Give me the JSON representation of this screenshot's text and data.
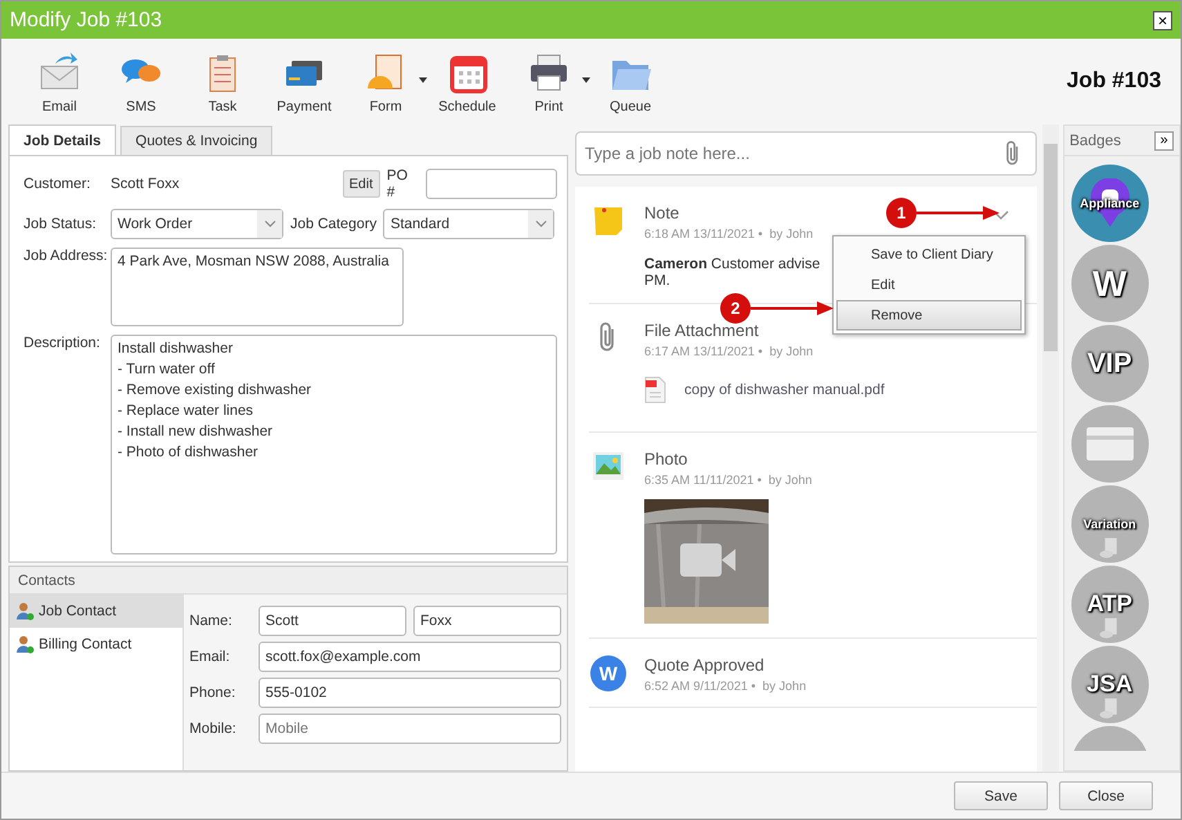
{
  "window": {
    "title": "Modify Job #103",
    "close": "×"
  },
  "toolbar": [
    {
      "label": "Email",
      "dropdown": false
    },
    {
      "label": "SMS",
      "dropdown": false
    },
    {
      "label": "Task",
      "dropdown": false
    },
    {
      "label": "Payment",
      "dropdown": false
    },
    {
      "label": "Form",
      "dropdown": true
    },
    {
      "label": "Schedule",
      "dropdown": false
    },
    {
      "label": "Print",
      "dropdown": true
    },
    {
      "label": "Queue",
      "dropdown": false
    }
  ],
  "job_number": "Job #103",
  "tabs": [
    {
      "label": "Job Details",
      "selected": true
    },
    {
      "label": "Quotes & Invoicing",
      "selected": false
    }
  ],
  "form": {
    "customer_label": "Customer:",
    "customer": "Scott Foxx",
    "edit_button": "Edit",
    "po_label": "PO #",
    "status_label": "Job Status:",
    "status": "Work Order",
    "category_label": "Job Category",
    "category": "Standard",
    "address_label": "Job Address:",
    "address": "4 Park Ave, Mosman NSW 2088, Australia",
    "description_label": "Description:",
    "description": "Install dishwasher\n- Turn water off\n- Remove existing dishwasher\n- Replace water lines\n- Install new dishwasher\n- Photo of dishwasher"
  },
  "contacts": {
    "title": "Contacts",
    "items": [
      {
        "label": "Job Contact",
        "selected": true
      },
      {
        "label": "Billing Contact",
        "selected": false
      }
    ],
    "fields": [
      {
        "label": "Name:",
        "values": [
          "Scott",
          "Foxx"
        ]
      },
      {
        "label": "Email:",
        "values": [
          "scott.fox@example.com"
        ]
      },
      {
        "label": "Phone:",
        "values": [
          "555-0102"
        ]
      },
      {
        "label": "Mobile:",
        "placeholder": "Mobile"
      }
    ]
  },
  "note_input": {
    "placeholder": "Type a job note here..."
  },
  "feed": [
    {
      "kind": "note",
      "title": "Note",
      "meta": "6:18 AM 13/11/2021 •",
      "by": "by John",
      "lines": [
        "**Cameron** Customer advise",
        "PM."
      ]
    },
    {
      "kind": "file",
      "title": "File Attachment",
      "meta": "6:17 AM 13/11/2021 •",
      "by": "by John",
      "file": "copy of dishwasher manual.pdf"
    },
    {
      "title": "Photo",
      "meta": "6:35 AM 11/11/2021 •",
      "by": "by John"
    },
    {
      "kind": "quote",
      "title": "Quote Approved",
      "meta": "6:52 AM 9/11/2021 •",
      "by": "by John",
      "avatar": "W"
    }
  ],
  "menu": {
    "items": [
      {
        "label": "Save to Client Diary",
        "hovered": false
      },
      {
        "label": "Edit",
        "hovered": false
      },
      {
        "label": "Remove",
        "hovered": true
      }
    ]
  },
  "callouts": [
    {
      "label": "1"
    },
    {
      "label": "2"
    }
  ],
  "badges": {
    "title": "Badges",
    "expand": "»",
    "items": [
      {
        "kind": "pin",
        "label": "Appliance",
        "active": true
      },
      {
        "kind": "text",
        "label": "W",
        "active": false
      },
      {
        "kind": "text",
        "label": "VIP",
        "active": false
      },
      {
        "kind": "card",
        "active": false
      },
      {
        "kind": "form",
        "label": "Variation",
        "active": false
      },
      {
        "kind": "form",
        "label": "ATP",
        "active": false
      },
      {
        "kind": "form",
        "label": "JSA",
        "active": false
      },
      {
        "kind": "partial",
        "active": false
      }
    ]
  },
  "footer": {
    "buttons": [
      "Save",
      "Close"
    ]
  }
}
